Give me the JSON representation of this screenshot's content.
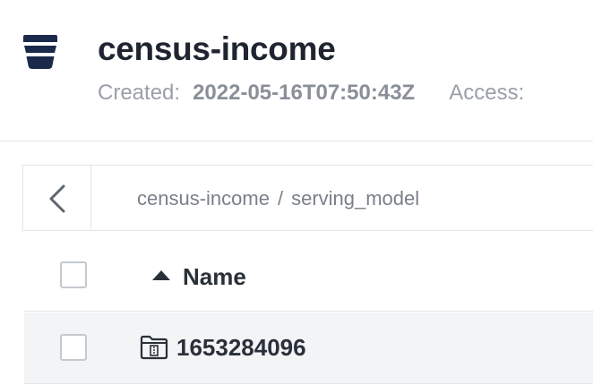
{
  "bucket": {
    "title": "census-income",
    "created_label": "Created:",
    "created_value": "2022-05-16T07:50:43Z",
    "access_label": "Access:"
  },
  "breadcrumb": {
    "root": "census-income",
    "separator": "/",
    "current": "serving_model"
  },
  "table": {
    "columns": [
      {
        "label": "Name",
        "sort": "ascending"
      }
    ],
    "rows": [
      {
        "name": "1653284096",
        "type": "folder"
      }
    ]
  },
  "icons": {
    "bucket": "bucket-icon",
    "back": "chevron-left-icon",
    "sort": "sort-ascending-icon",
    "folder": "folder-icon"
  },
  "colors": {
    "brand_dark": "#1b2a4a",
    "text_primary": "#1f2530",
    "text_muted": "#8a8f98",
    "row_hover": "#f3f4f6",
    "border": "#e3e5e8"
  }
}
